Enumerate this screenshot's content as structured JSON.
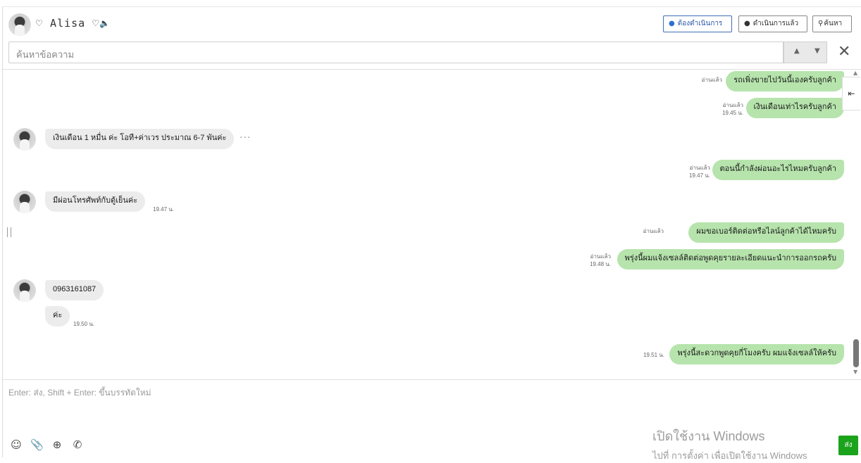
{
  "header": {
    "name": "♡ Alisa ♡",
    "speaker_icon": "🔈",
    "btn_todo": "ต้องดำเนินการ",
    "btn_done": "ดำเนินการแล้ว",
    "btn_search": "ค้นหา"
  },
  "search": {
    "placeholder": "ค้นหาข้อความ",
    "close": "✕"
  },
  "messages": {
    "m1": {
      "text": "รถเพิ่งขายไปวันนี้เองครับลูกค้า",
      "read": "อ่านแล้ว"
    },
    "m2": {
      "text": "เงินเดือนเท่าไรครับลูกค้า",
      "read": "อ่านแล้ว",
      "time": "19.45 น."
    },
    "m3": {
      "text": "เงินเดือน 1 หมื่น ค่ะ  โอที+ค่าเวร ประมาณ 6-7 พันค่ะ",
      "more": "···"
    },
    "m4": {
      "text": "ตอนนี้กำลังผ่อนอะไรไหมครับลูกค้า",
      "read": "อ่านแล้ว",
      "time": "19.47 น."
    },
    "m5": {
      "text": "มีผ่อนโทรศัพท์กับตู้เย็นค่ะ",
      "time": "19.47 น."
    },
    "m6": {
      "text": "ผมขอเบอร์ติดต่อหรือไลน์ลูกค้าได้ไหมครับ",
      "read": "อ่านแล้ว"
    },
    "m7": {
      "text": "พรุ่งนี้ผมแจ้งเซลล์ติดต่อพูดคุยรายละเอียดแนะนำการออกรถครับ",
      "read": "อ่านแล้ว",
      "time": "19.48 น."
    },
    "m8": {
      "text": "0963161087"
    },
    "m9": {
      "text": "ค่ะ",
      "time": "19.50 น."
    },
    "m10": {
      "text": "พรุ่งนี้สะดวกพูดคุยกี่โมงครับ ผมแจ้งเซลล์ให้ครับ",
      "time": "19.51 น."
    }
  },
  "composer": {
    "placeholder": "Enter: ส่ง, Shift + Enter: ขึ้นบรรทัดใหม่",
    "send": "ส่ง"
  },
  "watermark": {
    "line1": "เปิดใช้งาน Windows",
    "line2": "ไปที่ การตั้งค่า เพื่อเปิดใช้งาน Windows"
  }
}
